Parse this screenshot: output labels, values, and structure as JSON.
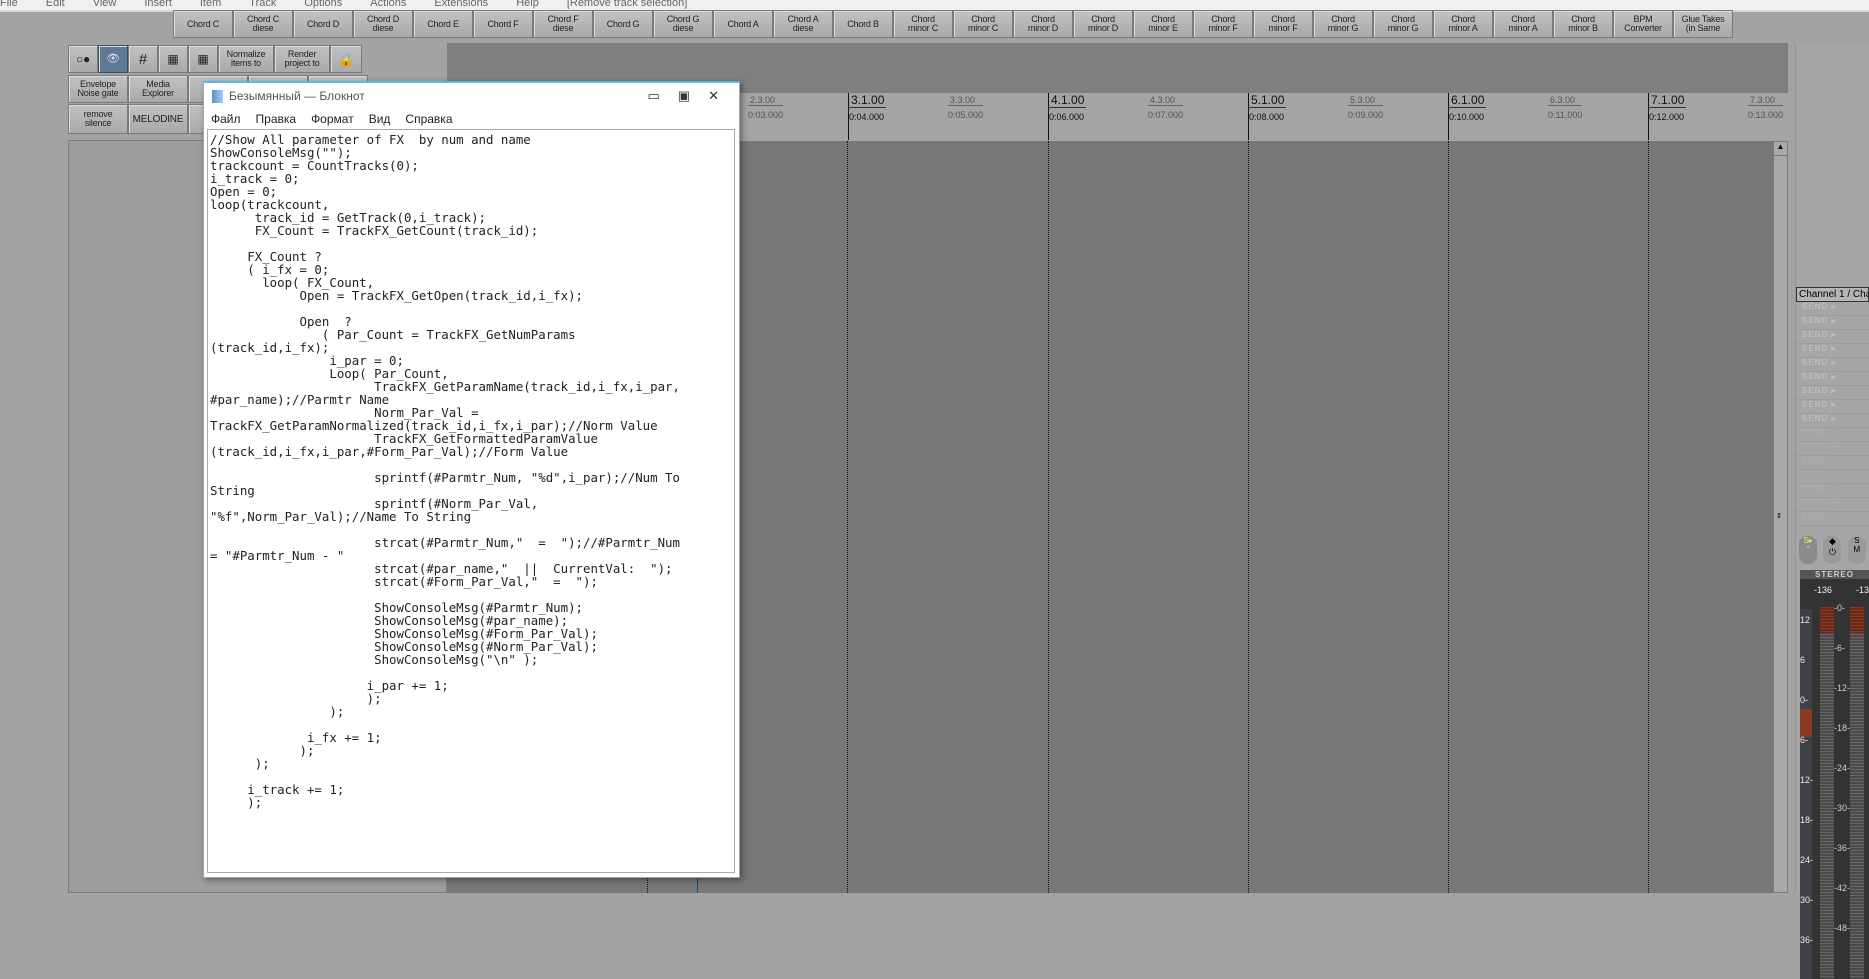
{
  "menubar": [
    "File",
    "Edit",
    "View",
    "Insert",
    "Item",
    "Track",
    "Options",
    "Actions",
    "Extensions",
    "Help",
    "[Remove track selection]"
  ],
  "toolbar": [
    "Chord C",
    "Chord C\ndiese",
    "Chord D",
    "Chord D\ndiese",
    "Chord E",
    "Chord F",
    "Chord F\ndiese",
    "Chord G",
    "Chord G\ndiese",
    "Chord A",
    "Chord A\ndiese",
    "Chord B",
    "Chord\nminor C",
    "Chord\nminor C",
    "Chord\nminor D",
    "Chord\nminor D",
    "Chord\nminor E",
    "Chord\nminor F",
    "Chord\nminor F",
    "Chord\nminor G",
    "Chord\nminor G",
    "Chord\nminor A",
    "Chord\nminor A",
    "Chord\nminor B",
    "BPM\nConverter",
    "Glue Takes\n(in Same"
  ],
  "tcp": {
    "normalize": "Normalize\nitems to",
    "render": "Render\nproject to",
    "envelope": "Envelope\nNoise gate",
    "media": "Media\nExplorer",
    "remove": "remove\nsilence",
    "melodine": "MELODINE"
  },
  "ruler": [
    {
      "m": "2.3.00",
      "t": "0:03.000",
      "half": true
    },
    {
      "m": "3.1.00",
      "t": "0:04.000"
    },
    {
      "m": "3.3.00",
      "t": "0:05.000",
      "half": true
    },
    {
      "m": "4.1.00",
      "t": "0:06.000"
    },
    {
      "m": "4.3.00",
      "t": "0:07.000",
      "half": true
    },
    {
      "m": "5.1.00",
      "t": "0:08.000"
    },
    {
      "m": "5.3.00",
      "t": "0:09.000",
      "half": true
    },
    {
      "m": "6.1.00",
      "t": "0:10.000"
    },
    {
      "m": "6.3.00",
      "t": "0:11.000",
      "half": true
    },
    {
      "m": "7.1.00",
      "t": "0:12.000"
    },
    {
      "m": "7.3.00",
      "t": "0:13.000",
      "half": true
    }
  ],
  "mixer": {
    "channel": "Channel 1 / Cha",
    "send": "SEND ▸",
    "send_count": 16,
    "stereo": "STEREO",
    "peak_l": "-136",
    "peak_r": "-136",
    "scale_left": [
      "12",
      "6",
      "0-",
      "6-",
      "12-",
      "18-",
      "24-",
      "30-",
      "36-"
    ],
    "scale_center": [
      "-0-",
      "-6-",
      "-12-",
      "-18-",
      "-24-",
      "-30-",
      "-36-",
      "-42-",
      "-48-"
    ]
  },
  "notepad": {
    "title": "Безымянный — Блокнот",
    "menu": [
      "Файл",
      "Правка",
      "Формат",
      "Вид",
      "Справка"
    ],
    "text": "//Show All parameter of FX  by num and name\nShowConsoleMsg(\"\");\ntrackcount = CountTracks(0);\ni_track = 0;\nOpen = 0;\nloop(trackcount,\n      track_id = GetTrack(0,i_track);\n      FX_Count = TrackFX_GetCount(track_id);\n\n     FX_Count ?\n     ( i_fx = 0;\n       loop( FX_Count,\n            Open = TrackFX_GetOpen(track_id,i_fx);\n\n            Open  ?\n               ( Par_Count = TrackFX_GetNumParams\n(track_id,i_fx);\n                i_par = 0;\n                Loop( Par_Count,\n                      TrackFX_GetParamName(track_id,i_fx,i_par,\n#par_name);//Parmtr Name\n                      Norm_Par_Val =\nTrackFX_GetParamNormalized(track_id,i_fx,i_par);//Norm Value\n                      TrackFX_GetFormattedParamValue\n(track_id,i_fx,i_par,#Form_Par_Val);//Form Value\n\n                      sprintf(#Parmtr_Num, \"%d\",i_par);//Num To\nString\n                      sprintf(#Norm_Par_Val,\n\"%f\",Norm_Par_Val);//Name To String\n\n                      strcat(#Parmtr_Num,\"  =  \");//#Parmtr_Num\n= \"#Parmtr_Num - \"\n                      strcat(#par_name,\"  ||  CurrentVal:  \");\n                      strcat(#Form_Par_Val,\"  =  \");\n\n                      ShowConsoleMsg(#Parmtr_Num);\n                      ShowConsoleMsg(#par_name);\n                      ShowConsoleMsg(#Form_Par_Val);\n                      ShowConsoleMsg(#Norm_Par_Val);\n                      ShowConsoleMsg(\"\\n\" );\n\n                     i_par += 1;\n                     );\n                );\n\n             i_fx += 1;\n            );\n      );\n\n     i_track += 1;\n     );"
  },
  "colors": {
    "accent": "#5cb8e8",
    "meter_clip": "#8a3a22",
    "selected_btn": "#5e7a94"
  }
}
